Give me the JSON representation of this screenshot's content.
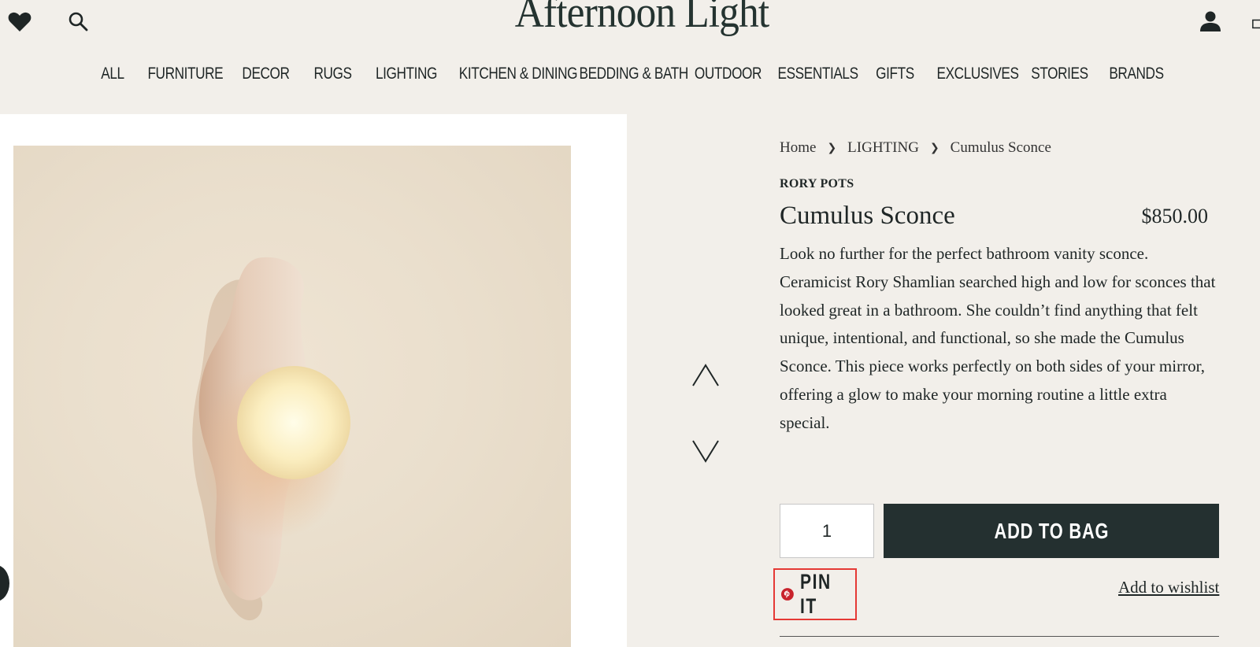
{
  "header": {
    "logo": "Afternoon Light",
    "icons": {
      "wishlist": "heart-icon",
      "search": "search-icon",
      "account": "user-icon",
      "bag": "bag-icon"
    }
  },
  "nav": {
    "items": [
      "ALL",
      "FURNITURE",
      "DECOR",
      "RUGS",
      "LIGHTING",
      "KITCHEN & DINING",
      "BEDDING & BATH",
      "OUTDOOR",
      "ESSENTIALS",
      "GIFTS",
      "EXCLUSIVES",
      "STORIES",
      "BRANDS"
    ]
  },
  "breadcrumb": {
    "home": "Home",
    "category": "LIGHTING",
    "current": "Cumulus Sconce"
  },
  "product": {
    "brand": "RORY POTS",
    "title": "Cumulus Sconce",
    "price": "$850.00",
    "description": "Look no further for the perfect bathroom vanity sconce. Ceramicist Rory Shamlian searched high and low for sconces that looked great in a bathroom. She couldn’t find anything that felt unique, intentional, and functional, so she made the Cumulus Sconce. This piece works perfectly on both sides of your mirror, offering a glow to make your morning routine a little extra special."
  },
  "purchase": {
    "quantity": "1",
    "add_to_bag": "ADD TO BAG",
    "pin_it": "PIN IT",
    "wishlist": "Add to wishlist"
  },
  "colors": {
    "background": "#f2efea",
    "button": "#243030",
    "pinterest": "#c8232c",
    "highlight": "#e53935"
  }
}
